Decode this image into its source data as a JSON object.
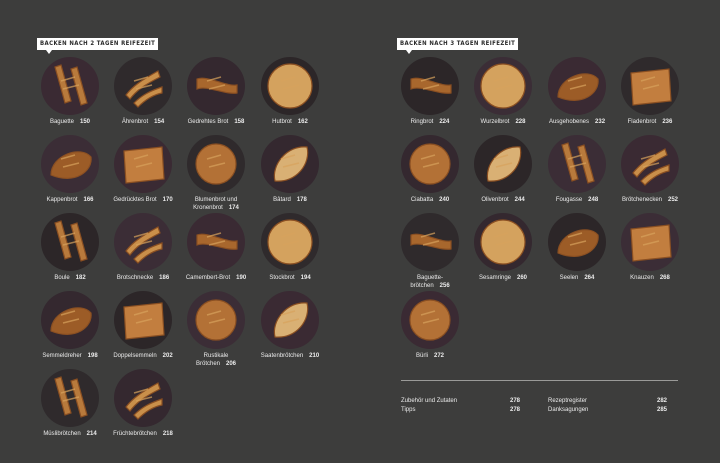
{
  "left_section": {
    "label": "BACKEN NACH 2 TAGEN REIFEZEIT",
    "items": [
      {
        "name": "Baguette",
        "page": "150"
      },
      {
        "name": "Ährenbrot",
        "page": "154"
      },
      {
        "name": "Gedrehtes Brot",
        "page": "158"
      },
      {
        "name": "Hutbrot",
        "page": "162"
      },
      {
        "name": "Kappenbrot",
        "page": "166"
      },
      {
        "name": "Gedrücktes Brot",
        "page": "170"
      },
      {
        "name": "Blumenbrot und Kronenbrot",
        "page": "174"
      },
      {
        "name": "Bâtard",
        "page": "178"
      },
      {
        "name": "Boule",
        "page": "182"
      },
      {
        "name": "Brotschnecke",
        "page": "186"
      },
      {
        "name": "Camembert-Brot",
        "page": "190"
      },
      {
        "name": "Stockbrot",
        "page": "194"
      },
      {
        "name": "Semmeldreher",
        "page": "198"
      },
      {
        "name": "Doppelsemmeln",
        "page": "202"
      },
      {
        "name": "Rustikale Brötchen",
        "page": "206"
      },
      {
        "name": "Saatenbrötchen",
        "page": "210"
      },
      {
        "name": "Müslibrötchen",
        "page": "214"
      },
      {
        "name": "Früchtebrötchen",
        "page": "218"
      }
    ]
  },
  "right_section": {
    "label": "BACKEN NACH 3 TAGEN REIFEZEIT",
    "items": [
      {
        "name": "Ringbrot",
        "page": "224"
      },
      {
        "name": "Wurzelbrot",
        "page": "228"
      },
      {
        "name": "Ausgehobenes",
        "page": "232"
      },
      {
        "name": "Fladenbrot",
        "page": "236"
      },
      {
        "name": "Ciabatta",
        "page": "240"
      },
      {
        "name": "Olivenbrot",
        "page": "244"
      },
      {
        "name": "Fougasse",
        "page": "248"
      },
      {
        "name": "Brötchenecken",
        "page": "252"
      },
      {
        "name": "Baguette-brötchen",
        "page": "256"
      },
      {
        "name": "Sesamringe",
        "page": "260"
      },
      {
        "name": "Seelen",
        "page": "264"
      },
      {
        "name": "Knauzen",
        "page": "268"
      },
      {
        "name": "Bürli",
        "page": "272"
      }
    ]
  },
  "appendix": [
    {
      "label": "Zubehör und Zutaten",
      "page": "278"
    },
    {
      "label": "Tipps",
      "page": "278"
    },
    {
      "label": "Rezeptregister",
      "page": "282"
    },
    {
      "label": "Danksagungen",
      "page": "285"
    }
  ],
  "colors": {
    "background": "#3d3d3c",
    "tag_background": "#ffffff",
    "crust_dark": "#8a4f22",
    "crust_light": "#d7a25d",
    "backdrop": "#3a2a33"
  }
}
